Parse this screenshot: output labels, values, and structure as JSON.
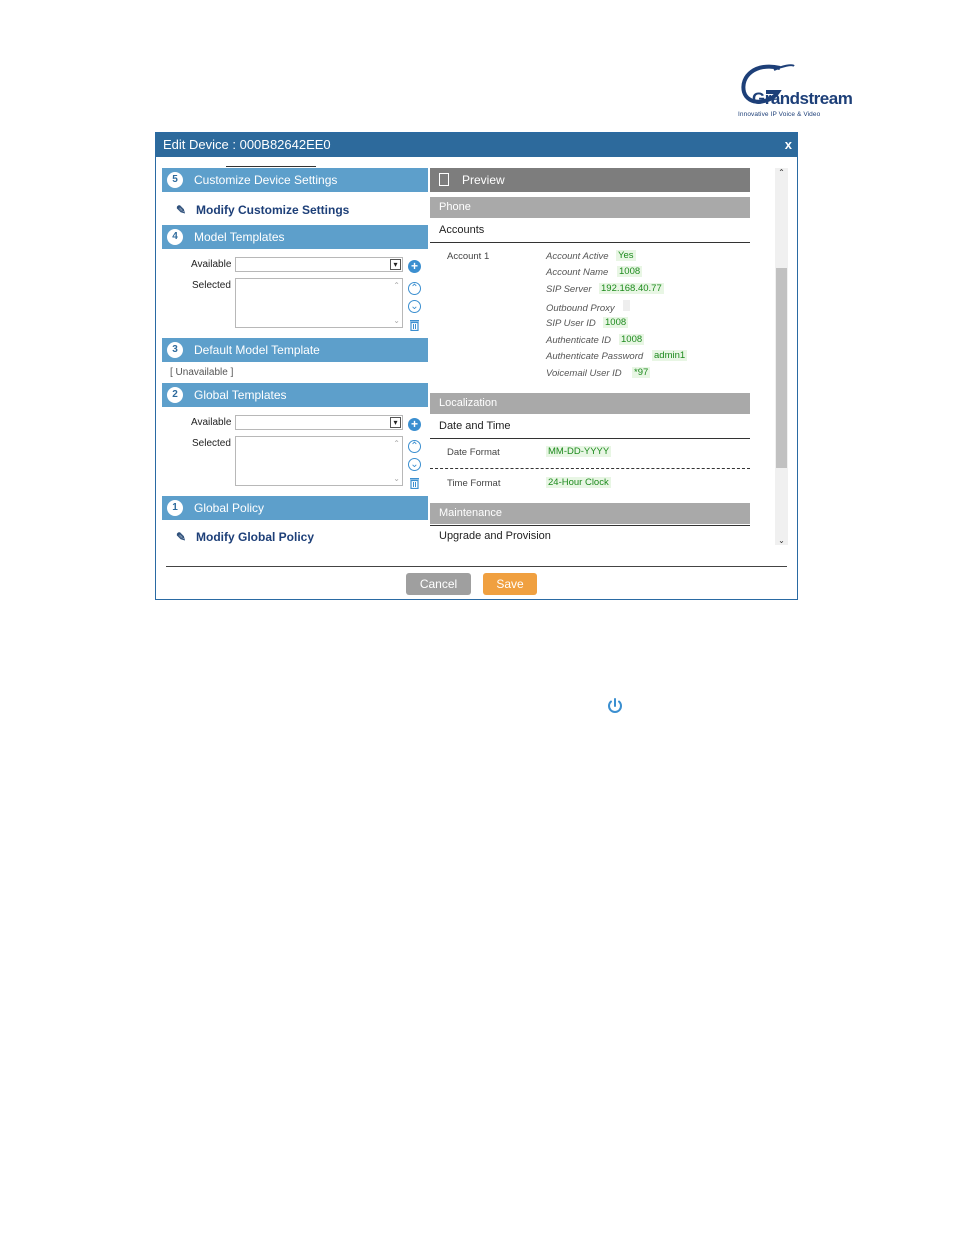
{
  "logo": {
    "brand": "Grandstream",
    "tagline": "Innovative IP Voice & Video"
  },
  "dialog": {
    "title": "Edit Device : 000B82642EE0",
    "close_label": "x",
    "cancel_label": "Cancel",
    "save_label": "Save"
  },
  "left": {
    "customize": {
      "number": "5",
      "label": "Customize Device Settings",
      "link": "Modify Customize Settings"
    },
    "model_templates": {
      "number": "4",
      "label": "Model Templates",
      "available_label": "Available",
      "selected_label": "Selected"
    },
    "default_model": {
      "number": "3",
      "label": "Default Model Template",
      "value": "[ Unavailable ]"
    },
    "global_templates": {
      "number": "2",
      "label": "Global Templates",
      "available_label": "Available",
      "selected_label": "Selected"
    },
    "global_policy": {
      "number": "1",
      "label": "Global Policy",
      "link": "Modify Global Policy"
    }
  },
  "preview": {
    "title": "Preview",
    "phone": {
      "header": "Phone",
      "subheader": "Accounts",
      "account_label": "Account 1",
      "fields": [
        {
          "label": "Account Active",
          "value": "Yes"
        },
        {
          "label": "Account Name",
          "value": "1008"
        },
        {
          "label": "SIP Server",
          "value": "192.168.40.77"
        },
        {
          "label": "Outbound Proxy",
          "value": ""
        },
        {
          "label": "SIP User ID",
          "value": "1008"
        },
        {
          "label": "Authenticate ID",
          "value": "1008"
        },
        {
          "label": "Authenticate Password",
          "value": "admin1"
        },
        {
          "label": "Voicemail User ID",
          "value": "*97"
        }
      ]
    },
    "localization": {
      "header": "Localization",
      "subheader": "Date and Time",
      "date_format_label": "Date Format",
      "date_format_value": "MM-DD-YYYY",
      "time_format_label": "Time Format",
      "time_format_value": "24-Hour Clock"
    },
    "maintenance": {
      "header": "Maintenance",
      "subheader": "Upgrade and Provision"
    }
  },
  "icons": {
    "power": "power-icon",
    "pencil": "pencil-icon",
    "add": "plus-circle-icon",
    "up": "arrow-up-circle-icon",
    "down": "arrow-down-circle-icon",
    "delete": "trash-icon",
    "doc": "document-icon"
  },
  "colors": {
    "title_bar": "#2d6a9c",
    "section_header": "#5d9fcb",
    "preview_header": "#7d7d7d",
    "save": "#f0a040",
    "cancel": "#9f9f9f",
    "value_green": "#1c8a1c"
  }
}
